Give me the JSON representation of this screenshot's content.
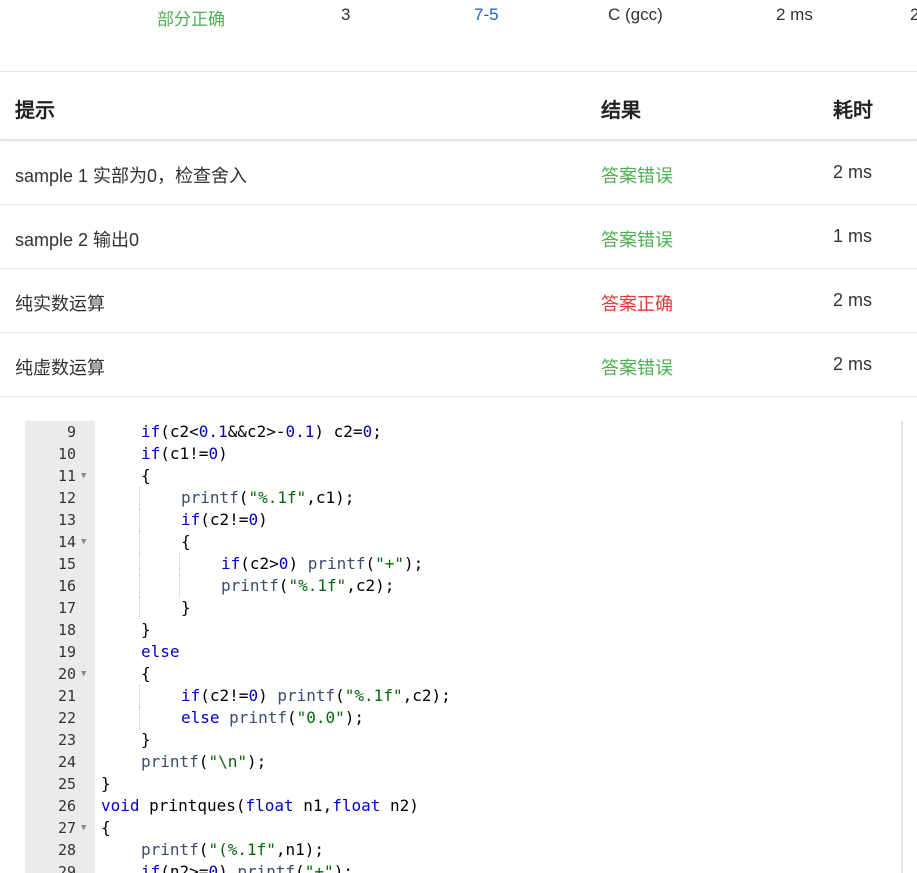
{
  "submission": {
    "status": "部分正确",
    "score": "3",
    "problem": "7-5",
    "compiler": "C (gcc)",
    "time": "2 ms",
    "memory_partial": "2"
  },
  "result_table": {
    "headers": {
      "hint": "提示",
      "result": "结果",
      "time": "耗时"
    },
    "rows": [
      {
        "hint": "sample 1 实部为0，检查舍入",
        "result": "答案错误",
        "time": "2 ms",
        "status_color": "#4caf50"
      },
      {
        "hint": "sample 2 输出0",
        "result": "答案错误",
        "time": "1 ms",
        "status_color": "#4caf50"
      },
      {
        "hint": "纯实数运算",
        "result": "答案正确",
        "time": "2 ms",
        "status_color": "#e53935"
      },
      {
        "hint": "纯虚数运算",
        "result": "答案错误",
        "time": "2 ms",
        "status_color": "#4caf50"
      }
    ]
  },
  "code_editor": {
    "lines": [
      {
        "n": "9",
        "fold": false,
        "indent": 1,
        "text": "if(c2<0.1&&c2>-0.1) c2=0;"
      },
      {
        "n": "10",
        "fold": false,
        "indent": 1,
        "text": "if(c1!=0)"
      },
      {
        "n": "11",
        "fold": true,
        "indent": 1,
        "text": "{"
      },
      {
        "n": "12",
        "fold": false,
        "indent": 2,
        "text": "printf(\"%.1f\",c1);"
      },
      {
        "n": "13",
        "fold": false,
        "indent": 2,
        "text": "if(c2!=0)"
      },
      {
        "n": "14",
        "fold": true,
        "indent": 2,
        "text": "{"
      },
      {
        "n": "15",
        "fold": false,
        "indent": 3,
        "text": "if(c2>0) printf(\"+\");"
      },
      {
        "n": "16",
        "fold": false,
        "indent": 3,
        "text": "printf(\"%.1f\",c2);"
      },
      {
        "n": "17",
        "fold": false,
        "indent": 2,
        "text": "}"
      },
      {
        "n": "18",
        "fold": false,
        "indent": 1,
        "text": "}"
      },
      {
        "n": "19",
        "fold": false,
        "indent": 1,
        "text": "else"
      },
      {
        "n": "20",
        "fold": true,
        "indent": 1,
        "text": "{"
      },
      {
        "n": "21",
        "fold": false,
        "indent": 2,
        "text": "if(c2!=0) printf(\"%.1f\",c2);"
      },
      {
        "n": "22",
        "fold": false,
        "indent": 2,
        "text": "else printf(\"0.0\");"
      },
      {
        "n": "23",
        "fold": false,
        "indent": 1,
        "text": "}"
      },
      {
        "n": "24",
        "fold": false,
        "indent": 1,
        "text": "printf(\"\\n\");"
      },
      {
        "n": "25",
        "fold": false,
        "indent": 0,
        "text": "}"
      },
      {
        "n": "26",
        "fold": false,
        "indent": 0,
        "text": "void printques(float n1,float n2)"
      },
      {
        "n": "27",
        "fold": true,
        "indent": 0,
        "text": "{"
      },
      {
        "n": "28",
        "fold": false,
        "indent": 1,
        "text": "printf(\"(%.1f\",n1);"
      },
      {
        "n": "29",
        "fold": false,
        "indent": 1,
        "text": "if(n2>=0) printf(\"+\");"
      }
    ]
  }
}
